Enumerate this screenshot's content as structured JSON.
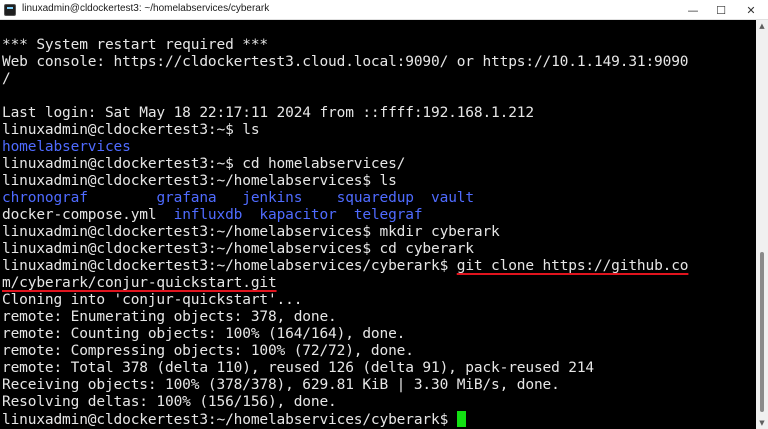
{
  "window": {
    "title": "linuxadmin@cldockertest3: ~/homelabservices/cyberark",
    "minimize": "—",
    "maximize": "☐",
    "close": "✕"
  },
  "terminal": {
    "lines": [
      {
        "text": "*** System restart required ***"
      },
      {
        "text": "Web console: https://cldockertest3.cloud.local:9090/ or https://10.1.149.31:9090"
      },
      {
        "text": "/"
      },
      {
        "text": ""
      },
      {
        "text": "Last login: Sat May 18 22:17:11 2024 from ::ffff:192.168.1.212"
      },
      {
        "text": "linuxadmin@cldockertest3:~$ ls"
      },
      {
        "text": "homelabservices",
        "style": "blue"
      },
      {
        "text": "linuxadmin@cldockertest3:~$ cd homelabservices/"
      },
      {
        "text": "linuxadmin@cldockertest3:~/homelabservices$ ls"
      },
      {
        "segments": [
          {
            "text": "chronograf",
            "style": "blue"
          },
          {
            "text": "        "
          },
          {
            "text": "grafana",
            "style": "blue"
          },
          {
            "text": "   "
          },
          {
            "text": "jenkins",
            "style": "blue"
          },
          {
            "text": "    "
          },
          {
            "text": "squaredup",
            "style": "blue"
          },
          {
            "text": "  "
          },
          {
            "text": "vault",
            "style": "blue"
          }
        ]
      },
      {
        "segments": [
          {
            "text": "docker-compose.yml  "
          },
          {
            "text": "influxdb",
            "style": "blue"
          },
          {
            "text": "  "
          },
          {
            "text": "kapacitor",
            "style": "blue"
          },
          {
            "text": "  "
          },
          {
            "text": "telegraf",
            "style": "blue"
          }
        ]
      },
      {
        "text": "linuxadmin@cldockertest3:~/homelabservices$ mkdir cyberark"
      },
      {
        "text": "linuxadmin@cldockertest3:~/homelabservices$ cd cyberark"
      },
      {
        "segments": [
          {
            "text": "linuxadmin@cldockertest3:~/homelabservices/cyberark$ "
          },
          {
            "text": "git clone https://github.co",
            "style": "ul"
          }
        ]
      },
      {
        "text": "m/cyberark/conjur-quickstart.git",
        "style": "ul"
      },
      {
        "text": "Cloning into 'conjur-quickstart'..."
      },
      {
        "text": "remote: Enumerating objects: 378, done."
      },
      {
        "text": "remote: Counting objects: 100% (164/164), done."
      },
      {
        "text": "remote: Compressing objects: 100% (72/72), done."
      },
      {
        "text": "remote: Total 378 (delta 110), reused 126 (delta 91), pack-reused 214"
      },
      {
        "text": "Receiving objects: 100% (378/378), 629.81 KiB | 3.30 MiB/s, done."
      },
      {
        "text": "Resolving deltas: 100% (156/156), done."
      },
      {
        "text": "linuxadmin@cldockertest3:~/homelabservices/cyberark$ ",
        "cursor": true
      }
    ]
  },
  "colors": {
    "terminal_bg": "#000000",
    "text": "#e6e6e6",
    "directory": "#4f6bff",
    "highlight_underline": "#e0141e",
    "cursor": "#13e013"
  },
  "icons": {
    "app": "terminal-icon",
    "scroll_up": "triangle-up-icon",
    "scroll_down": "triangle-down-icon"
  }
}
